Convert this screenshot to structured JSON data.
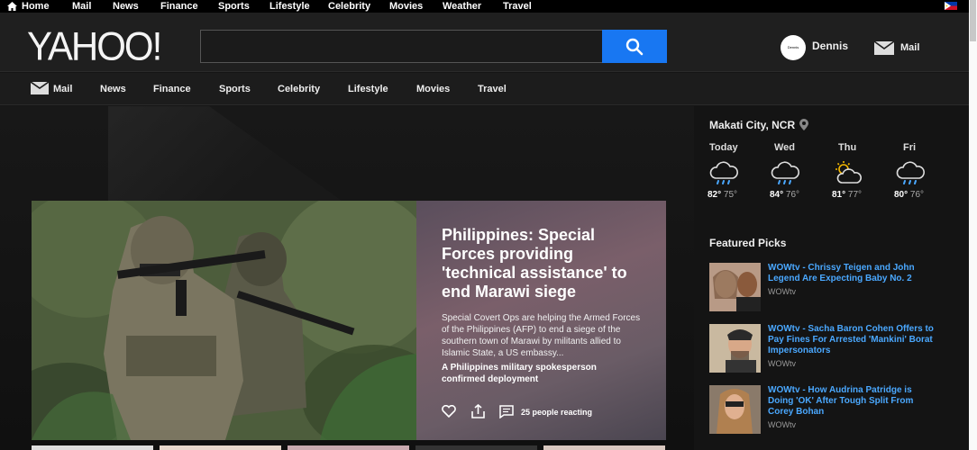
{
  "topbar": {
    "items": [
      "Home",
      "Mail",
      "News",
      "Finance",
      "Sports",
      "Lifestyle",
      "Celebrity",
      "Movies",
      "Weather",
      "Travel"
    ]
  },
  "header": {
    "logo": "YAHOO!",
    "search_value": "",
    "user_name": "Dennis",
    "mail_label": "Mail",
    "avatar_text": "Dennis"
  },
  "nav": {
    "items": [
      "Mail",
      "News",
      "Finance",
      "Sports",
      "Celebrity",
      "Lifestyle",
      "Movies",
      "Travel"
    ]
  },
  "hero": {
    "title": "Philippines: Special Forces providing 'technical assistance' to end Marawi siege",
    "description": "Special Covert Ops are helping the Armed Forces of the Philippines (AFP) to end a siege of the southern town of Marawi by militants allied to Islamic State, a US embassy...",
    "subtitle": "A Philippines military spokesperson confirmed deployment",
    "reactions": "25 people reacting"
  },
  "weather": {
    "location": "Makati City, NCR",
    "days": [
      {
        "day": "Today",
        "icon": "rain-cloud-icon",
        "hi": "82°",
        "lo": "75°"
      },
      {
        "day": "Wed",
        "icon": "rain-cloud-icon",
        "hi": "84°",
        "lo": "76°"
      },
      {
        "day": "Thu",
        "icon": "sun-cloud-icon",
        "hi": "81°",
        "lo": "77°"
      },
      {
        "day": "Fri",
        "icon": "rain-cloud-icon",
        "hi": "80°",
        "lo": "76°"
      }
    ]
  },
  "featured": {
    "heading": "Featured Picks",
    "items": [
      {
        "title": "WOWtv - Chrissy Teigen and John Legend Are Expecting Baby No. 2",
        "source": "WOWtv"
      },
      {
        "title": "WOWtv - Sacha Baron Cohen Offers to Pay Fines For Arrested 'Mankini' Borat Impersonators",
        "source": "WOWtv"
      },
      {
        "title": "WOWtv - How Audrina Patridge is Doing 'OK' After Tough Split From Corey Bohan",
        "source": "WOWtv"
      }
    ]
  },
  "colors": {
    "search_button": "#1877f2",
    "link": "#4aa8ff"
  }
}
